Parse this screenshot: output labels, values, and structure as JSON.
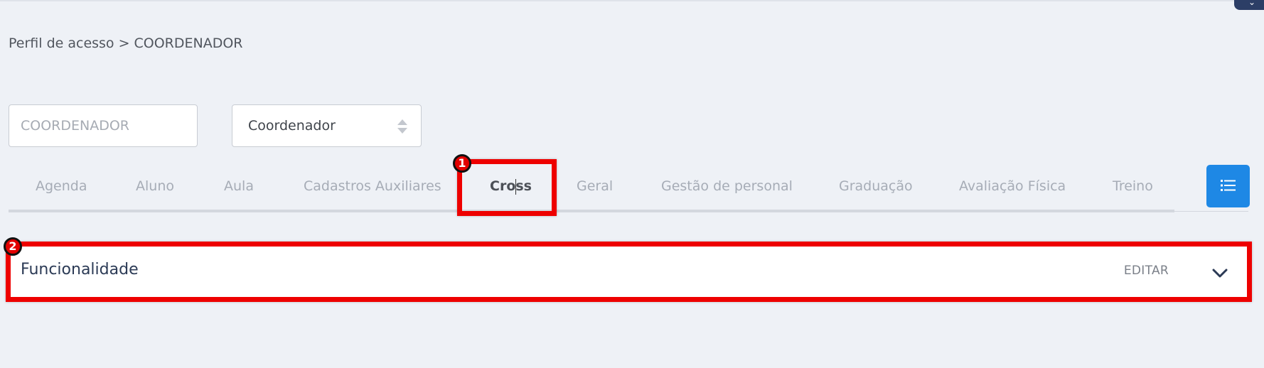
{
  "breadcrumb": {
    "parent": "Perfil de acesso",
    "separator": ">",
    "current": "COORDENADOR"
  },
  "form": {
    "name_placeholder": "COORDENADOR",
    "type_select_value": "Coordenador"
  },
  "tabs": [
    {
      "label": "Agenda",
      "active": false
    },
    {
      "label": "Aluno",
      "active": false
    },
    {
      "label": "Aula",
      "active": false
    },
    {
      "label": "Cadastros Auxiliares",
      "active": false
    },
    {
      "label": "Cross",
      "active": true
    },
    {
      "label": "Geral",
      "active": false
    },
    {
      "label": "Gestão de personal",
      "active": false
    },
    {
      "label": "Graduação",
      "active": false
    },
    {
      "label": "Avaliação Física",
      "active": false
    },
    {
      "label": "Treino",
      "active": false
    }
  ],
  "list_button": {
    "icon": "list-icon"
  },
  "panel": {
    "title": "Funcionalidade",
    "edit_label": "EDITAR",
    "chevron_icon": "chevron-down-icon"
  },
  "annotations": [
    {
      "number": "1",
      "target": "Cross tab"
    },
    {
      "number": "2",
      "target": "Funcionalidade panel"
    }
  ],
  "colors": {
    "background": "#eef1f6",
    "accent_blue": "#1e88e5",
    "highlight_red": "#ee0000",
    "title_navy": "#2b3a55"
  }
}
